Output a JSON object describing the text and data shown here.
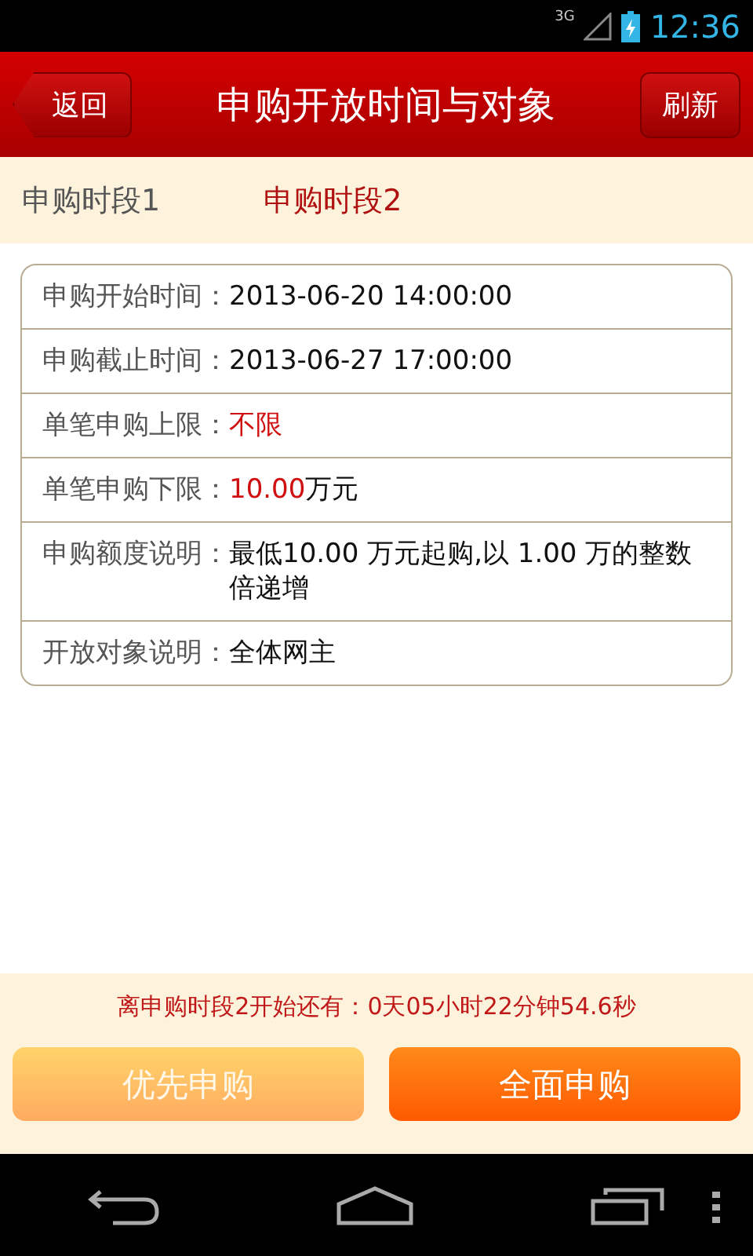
{
  "status_bar": {
    "network": "3G",
    "time": "12:36"
  },
  "header": {
    "back": "返回",
    "title": "申购开放时间与对象",
    "refresh": "刷新"
  },
  "tabs": [
    {
      "label": "申购时段1",
      "selected": false
    },
    {
      "label": "申购时段2",
      "selected": true
    }
  ],
  "details": [
    {
      "label": "申购开始时间：",
      "value": [
        {
          "text": "2013-06-20 14:00:00",
          "emphasis": false
        }
      ]
    },
    {
      "label": "申购截止时间：",
      "value": [
        {
          "text": "2013-06-27 17:00:00",
          "emphasis": false
        }
      ]
    },
    {
      "label": "单笔申购上限：",
      "value": [
        {
          "text": "不限",
          "emphasis": true
        }
      ]
    },
    {
      "label": "单笔申购下限：",
      "value": [
        {
          "text": "10.00",
          "emphasis": true
        },
        {
          "text": "万元",
          "emphasis": false
        }
      ]
    },
    {
      "label": "申购额度说明：",
      "value": [
        {
          "text": "最低10.00 万元起购,以 1.00 万的整数倍递增",
          "emphasis": false
        }
      ]
    },
    {
      "label": "开放对象说明：",
      "value": [
        {
          "text": "全体网主",
          "emphasis": false
        }
      ]
    }
  ],
  "countdown": "离申购时段2开始还有：0天05小时22分钟54.6秒",
  "actions": [
    {
      "label": "优先申购",
      "disabled": true
    },
    {
      "label": "全面申购",
      "disabled": false
    }
  ]
}
